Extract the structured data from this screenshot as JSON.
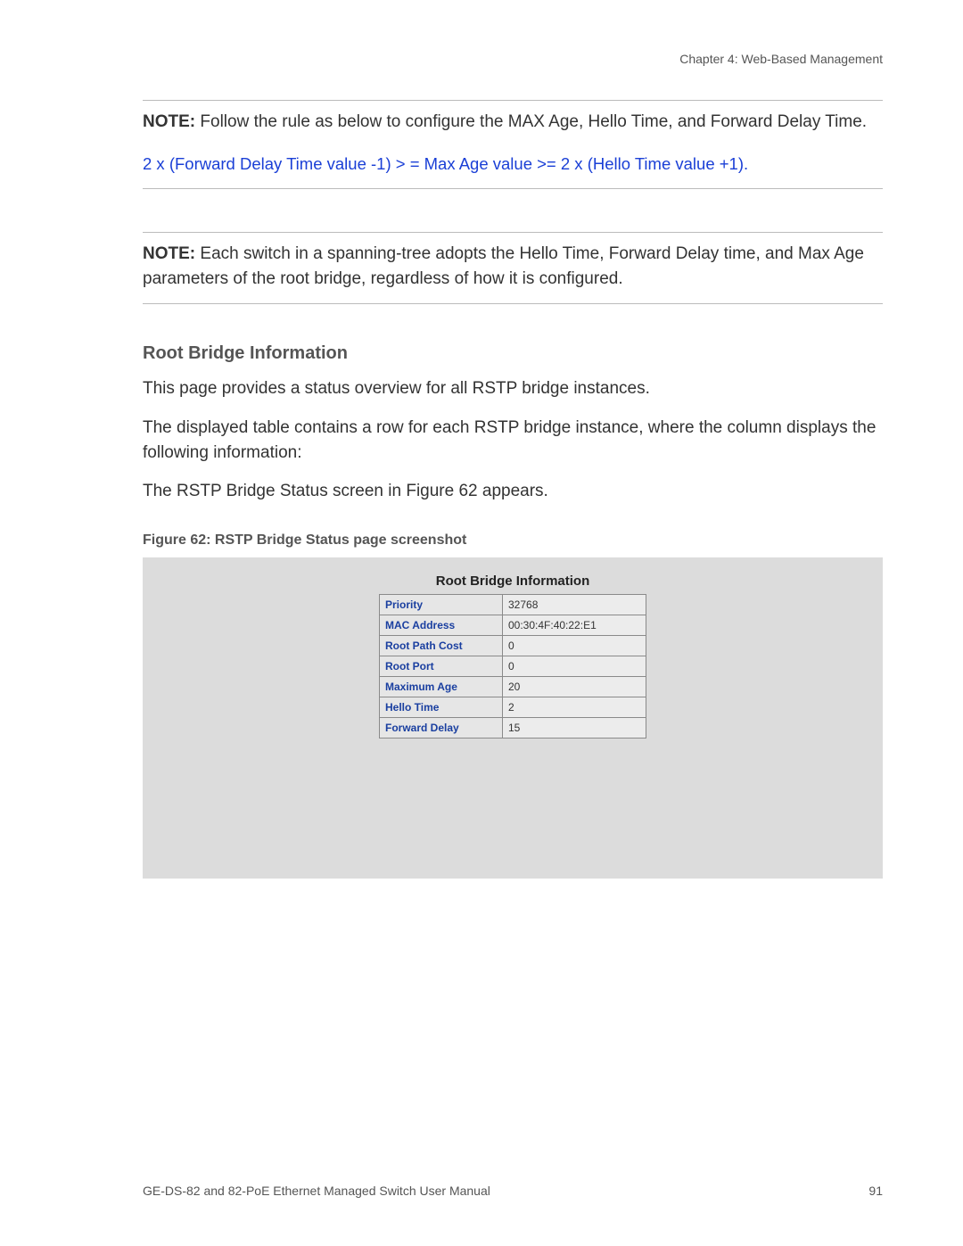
{
  "header": {
    "chapter": "Chapter 4: Web-Based Management"
  },
  "note1": {
    "label": "NOTE:",
    "text": "Follow the rule as below to configure the MAX Age, Hello Time, and Forward Delay Time.",
    "formula": "2 x (Forward Delay Time value -1) > = Max Age value >= 2 x (Hello Time value +1)."
  },
  "note2": {
    "label": "NOTE:",
    "text": "Each switch in a spanning-tree adopts the Hello Time, Forward Delay time, and Max Age parameters of the root bridge, regardless of how it is configured."
  },
  "section": {
    "title": "Root Bridge Information",
    "p1": "This page provides a status overview for all RSTP bridge instances.",
    "p2": "The displayed table contains a row for each RSTP bridge instance, where the column displays the following information:",
    "p3": "The RSTP Bridge Status screen in Figure 62 appears."
  },
  "figure": {
    "caption": "Figure 62: RSTP Bridge Status page screenshot",
    "title": "Root Bridge Information",
    "rows": [
      {
        "label": "Priority",
        "value": "32768"
      },
      {
        "label": "MAC Address",
        "value": "00:30:4F:40:22:E1"
      },
      {
        "label": "Root Path Cost",
        "value": "0"
      },
      {
        "label": "Root Port",
        "value": "0"
      },
      {
        "label": "Maximum Age",
        "value": "20"
      },
      {
        "label": "Hello Time",
        "value": "2"
      },
      {
        "label": "Forward Delay",
        "value": "15"
      }
    ]
  },
  "footer": {
    "manual": "GE-DS-82 and 82-PoE Ethernet Managed Switch User Manual",
    "page": "91"
  }
}
